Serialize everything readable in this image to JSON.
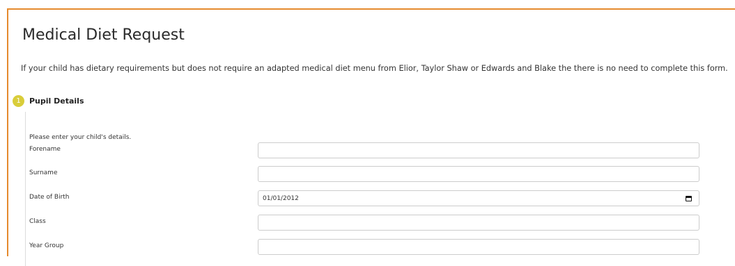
{
  "page": {
    "title": "Medical Diet Request",
    "intro": "If your child has dietary requirements but does not require an adapted medical diet menu from Elior, Taylor Shaw or Edwards and Blake the there is no need to complete this form."
  },
  "section": {
    "step_number": "1",
    "title": "Pupil Details",
    "hint": "Please enter your child's details."
  },
  "fields": {
    "forename": {
      "label": "Forename",
      "value": ""
    },
    "surname": {
      "label": "Surname",
      "value": ""
    },
    "date_of_birth": {
      "label": "Date of Birth",
      "value": "01/01/2012"
    },
    "class": {
      "label": "Class",
      "value": ""
    },
    "year_group": {
      "label": "Year Group",
      "value": ""
    }
  },
  "colors": {
    "accent_border": "#e58a2e",
    "step_badge": "#d9cd3a"
  },
  "icons": {
    "date_picker": "calendar-icon"
  }
}
